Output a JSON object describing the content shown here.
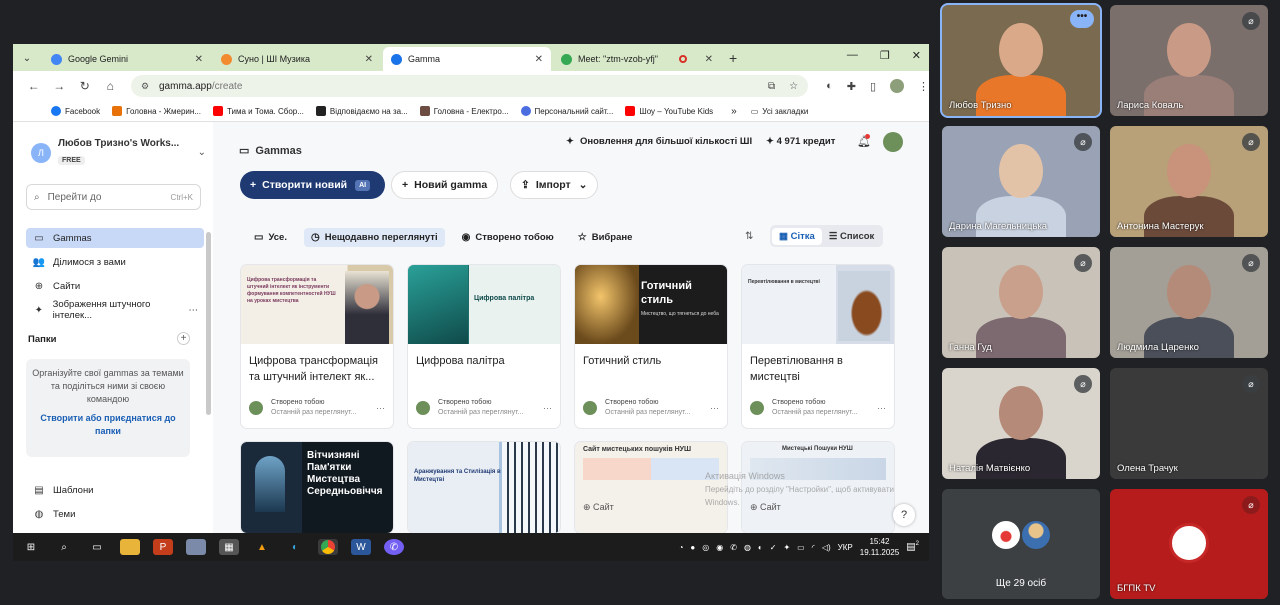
{
  "browser": {
    "tabs": [
      {
        "label": "Google Gemini",
        "color": "#4285f4",
        "active": false
      },
      {
        "label": "Суно | ШІ Музика",
        "color": "#f28b30",
        "active": false
      },
      {
        "label": "Gamma",
        "color": "#1a73e8",
        "active": true
      },
      {
        "label": "Meet: \"ztm-vzob-yfj\"",
        "color": "#34a853",
        "active": false
      }
    ],
    "url_host": "gamma.app",
    "url_path": "/create",
    "bookmarks": [
      {
        "label": "Facebook",
        "color": "#1877f2"
      },
      {
        "label": "Головна - Жмерин...",
        "color": "#e8710a"
      },
      {
        "label": "Тима и Тома. Сбор...",
        "color": "#ff0000"
      },
      {
        "label": "Відповідаємо на за...",
        "color": "#222222"
      },
      {
        "label": "Головна - Електро...",
        "color": "#6d4c41"
      },
      {
        "label": "Персональний сайт...",
        "color": "#4a6ee0"
      },
      {
        "label": "Шоу – YouTube Kids",
        "color": "#ff0000"
      }
    ],
    "bookmarks_more": "»",
    "all_bookmarks": "Усі закладки"
  },
  "sidebar": {
    "workspace_initial": "Л",
    "workspace_name": "Любов Тризно's Works...",
    "plan_badge": "FREE",
    "search_placeholder": "Перейти до",
    "search_shortcut": "Ctrl+K",
    "nav": [
      {
        "label": "Gammas",
        "icon": "gammas-icon",
        "active": true
      },
      {
        "label": "Ділимося з вами",
        "icon": "shared-icon",
        "active": false
      },
      {
        "label": "Сайти",
        "icon": "globe-icon",
        "active": false
      },
      {
        "label": "Зображення штучного інтелек...",
        "icon": "sparkle-icon",
        "active": false
      }
    ],
    "folders_title": "Папки",
    "folders_text": "Організуйте свої gammas за темами та поділіться ними зі своєю командою",
    "folders_link": "Створити або приєднатися до папки",
    "bottom_nav": [
      {
        "label": "Шаблони",
        "icon": "templates-icon"
      },
      {
        "label": "Теми",
        "icon": "themes-icon"
      }
    ]
  },
  "main": {
    "title": "Gammas",
    "upgrade_label": "Оновлення для більшої кількості ШІ",
    "credits_label": "4 971 кредит",
    "create_button": "Створити новий",
    "ai_badge": "AI",
    "new_gamma_button": "Новий gamma",
    "import_button": "Імпорт",
    "filters": [
      {
        "label": "Усе.",
        "active": false
      },
      {
        "label": "Нещодавно переглянуті",
        "active": true
      },
      {
        "label": "Створено тобою",
        "active": false
      },
      {
        "label": "Вибране",
        "active": false
      }
    ],
    "view_grid": "Сітка",
    "view_list": "Список",
    "cards": [
      {
        "title": "Цифрова трансформація та штучний інтелект як...",
        "author": "Створено тобою",
        "meta": "Останній раз переглянут...",
        "thumb_text": "Цифрова трансформація та штучний інтелект як інструменти формування компетентностей НУШ на уроках мистецтва"
      },
      {
        "title": "Цифрова палітра",
        "author": "Створено тобою",
        "meta": "Останній раз переглянут...",
        "thumb_text": "Цифрова палітра"
      },
      {
        "title": "Готичний стиль",
        "author": "Створено тобою",
        "meta": "Останній раз переглянут...",
        "thumb_text": "Готичний стиль",
        "thumb_sub": "Мистецтво, що тягнеться до неба"
      },
      {
        "title": "Перевтілювання в мистецтві",
        "author": "Створено тобою",
        "meta": "Останній раз переглянут...",
        "thumb_text": "Перевтілювання в мистецтві"
      }
    ],
    "cards_row2": [
      {
        "thumb_text": "Вітчизняні Пам'ятки Мистецтва Середньовіччя"
      },
      {
        "thumb_text": "Аранжування та Стилізація в Мистецтві"
      },
      {
        "thumb_text": "Сайт мистецьких пошуків НУШ",
        "badge": "Сайт"
      },
      {
        "thumb_text": "Мистецькі Пошуки НУШ",
        "badge": "Сайт"
      }
    ],
    "help": "?",
    "watermark_line1": "Активація Windows",
    "watermark_line2": "Перейдіть до розділу \"Настройки\", щоб активувати Windows."
  },
  "taskbar": {
    "lang": "УКР",
    "time": "15:42",
    "date": "19.11.2025",
    "notif_count": "2"
  },
  "participants": [
    {
      "name": "Любов Тризно",
      "speaking": true,
      "bg": "#7a6a4f",
      "skin": "#d9a98a",
      "cloth": "#e8772a"
    },
    {
      "name": "Лариса Коваль",
      "speaking": false,
      "bg": "#7b6f6c",
      "skin": "#c99a86",
      "cloth": "#9a7f78"
    },
    {
      "name": "Дарина Магельницька",
      "speaking": false,
      "bg": "#9aa3b5",
      "skin": "#e2c3a8",
      "cloth": "#c9d2e0"
    },
    {
      "name": "Антонина Мастерук",
      "speaking": false,
      "bg": "#b8a078",
      "skin": "#c8937a",
      "cloth": "#6b4a3a"
    },
    {
      "name": "Ганна Гуд",
      "speaking": false,
      "bg": "#c9c2b8",
      "skin": "#c9a08c",
      "cloth": "#7d6a70"
    },
    {
      "name": "Людмила Царенко",
      "speaking": false,
      "bg": "#a39f97",
      "skin": "#b48b79",
      "cloth": "#4b4f59"
    },
    {
      "name": "Наталія Матвієнко",
      "speaking": false,
      "bg": "#d9d4cc",
      "skin": "#b58a78",
      "cloth": "#2b2730"
    },
    {
      "name": "Олена Трачук",
      "speaking": false,
      "bg": "#3a3a3a",
      "skin": "#3a3a3a",
      "cloth": "#3a3a3a"
    }
  ],
  "others_label": "Ще 29 осіб",
  "tv_label": "БГПК TV"
}
